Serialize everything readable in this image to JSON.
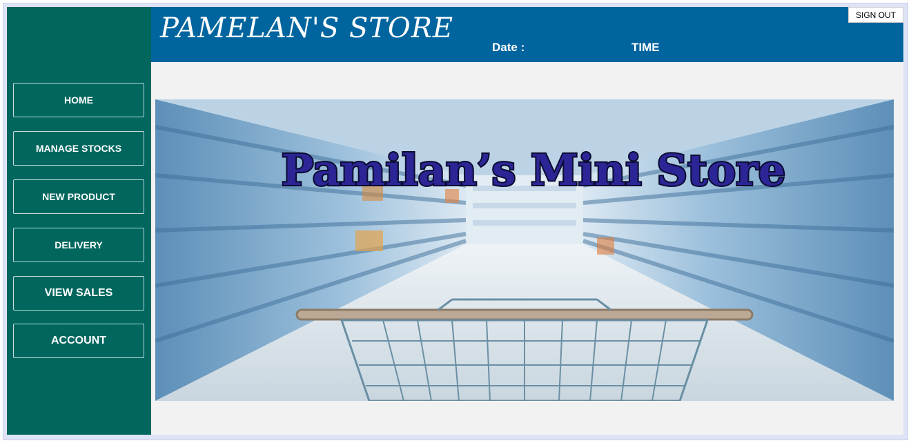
{
  "header": {
    "title": "PAMELAN'S STORE",
    "date_label": "Date :",
    "time_label": "TIME",
    "signout_label": "SIGN OUT"
  },
  "sidebar": {
    "items": [
      {
        "label": "HOME"
      },
      {
        "label": "MANAGE STOCKS"
      },
      {
        "label": "NEW PRODUCT"
      },
      {
        "label": "DELIVERY"
      },
      {
        "label": "VIEW SALES"
      },
      {
        "label": "ACCOUNT"
      }
    ]
  },
  "banner": {
    "text": "Pamilan’s Mini Store",
    "image": "supermarket-aisle-with-shopping-cart"
  },
  "colors": {
    "sidebar": "#00665e",
    "header": "#00659f",
    "content": "#f2f2f2",
    "banner_text": "#2b2596"
  }
}
